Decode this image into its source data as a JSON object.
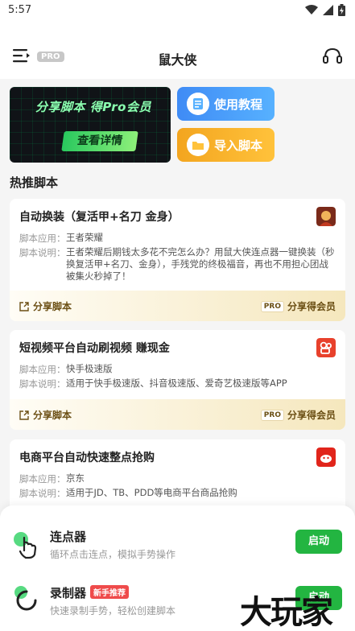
{
  "status": {
    "time": "5:57"
  },
  "appbar": {
    "title": "鼠大侠",
    "pro_badge": "PRO"
  },
  "banner": {
    "headline": "分享脚本 得Pro会员",
    "button": "查看详情"
  },
  "quick_actions": [
    {
      "label": "使用教程",
      "color": "#3f8bf5"
    },
    {
      "label": "导入脚本",
      "color": "#f3a51f"
    }
  ],
  "section_title": "热推脚本",
  "cards": [
    {
      "title": "自动换装（复活甲+名刀 金身）",
      "app_key": "脚本应用：",
      "app": "王者荣耀",
      "desc_key": "脚本说明：",
      "desc": "王者荣耀后期钱太多花不完怎么办？用鼠大侠连点器一键换装（秒换复活甲+名刀、金身），手残党的终极福音，再也不用担心团战被集火秒掉了！",
      "share": "分享脚本",
      "vip_badge": "PRO",
      "vip": "分享得会员"
    },
    {
      "title": "短视频平台自动刷视频 赚现金",
      "app_key": "脚本应用：",
      "app": "快手极速版",
      "desc_key": "脚本说明：",
      "desc": "适用于快手极速版、抖音极速版、爱奇艺极速版等APP",
      "share": "分享脚本",
      "vip_badge": "PRO",
      "vip": "分享得会员"
    },
    {
      "title": "电商平台自动快速整点抢购",
      "app_key": "脚本应用：",
      "app": "京东",
      "desc_key": "脚本说明：",
      "desc": "适用于JD、TB、PDD等电商平台商品抢购"
    }
  ],
  "tools": [
    {
      "name": "连点器",
      "desc": "循环点击连点，模拟手势操作",
      "button": "启动"
    },
    {
      "name": "录制器",
      "badge": "新手推荐",
      "desc": "快速录制手势，轻松创建脚本",
      "button": "启动"
    }
  ],
  "watermark": "大玩家",
  "colors": {
    "accent_green": "#23b541",
    "tutorial_blue": "#3f8bf5",
    "import_orange": "#f3a51f"
  }
}
